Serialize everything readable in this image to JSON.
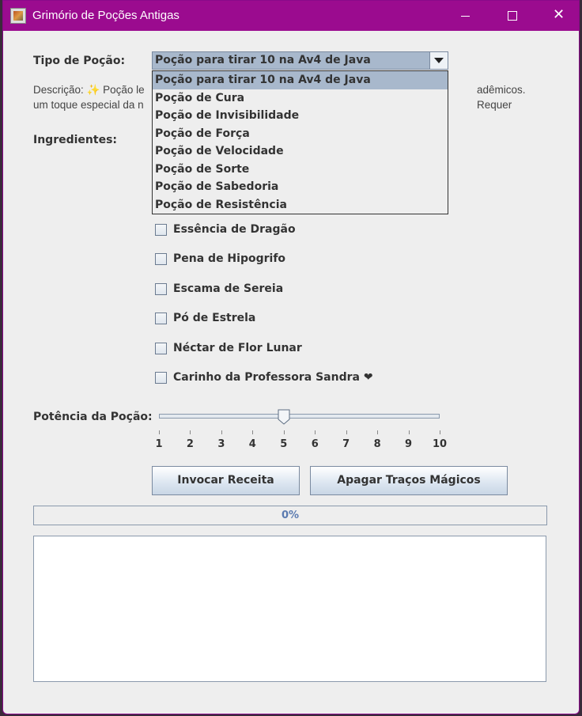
{
  "window": {
    "title": "Grimório de Poções Antigas",
    "controls": {
      "minimize": "minimize",
      "maximize": "maximize",
      "close": "✕"
    }
  },
  "potion_type": {
    "label": "Tipo de Poção:",
    "selected": "Poção para tirar 10 na Av4 de Java",
    "options": [
      "Poção para tirar 10 na Av4 de Java",
      "Poção de Cura",
      "Poção de Invisibilidade",
      "Poção de Força",
      "Poção de Velocidade",
      "Poção de Sorte",
      "Poção de Sabedoria",
      "Poção de Resistência"
    ]
  },
  "description": {
    "left_line1": "Descrição: ✨ Poção le",
    "right_line1": "adêmicos. Requer",
    "left_line2": "um toque especial da n"
  },
  "ingredients": {
    "label": "Ingredientes:",
    "items": [
      {
        "label": "Essência de Dragão",
        "checked": false
      },
      {
        "label": "Pena de Hipogrifo",
        "checked": false
      },
      {
        "label": "Escama de Sereia",
        "checked": false
      },
      {
        "label": "Pó de Estrela",
        "checked": false
      },
      {
        "label": "Néctar de Flor Lunar",
        "checked": false
      },
      {
        "label": "Carinho da Professora Sandra ❤",
        "checked": false
      }
    ]
  },
  "potency": {
    "label": "Potência da Poção:",
    "value": 5,
    "min": 1,
    "max": 10,
    "ticks": [
      "1",
      "2",
      "3",
      "4",
      "5",
      "6",
      "7",
      "8",
      "9",
      "10"
    ]
  },
  "buttons": {
    "invoke": "Invocar Receita",
    "clear": "Apagar Traços Mágicos"
  },
  "progress": {
    "text": "0%",
    "value": 0
  },
  "output": {
    "text": ""
  },
  "colors": {
    "titlebar": "#9b0b8f",
    "selection": "#a8b8cc",
    "progress_text": "#5a7ab0"
  }
}
